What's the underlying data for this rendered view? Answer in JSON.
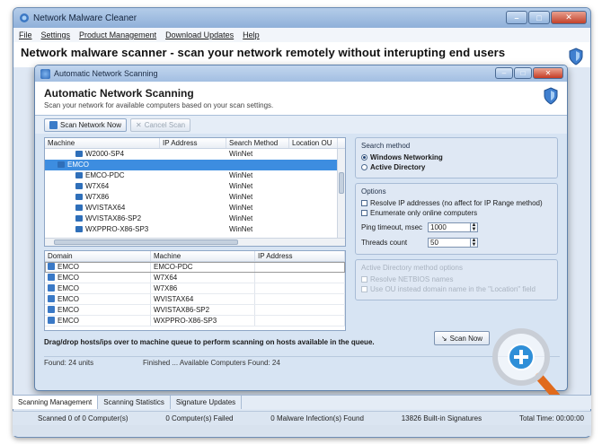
{
  "app": {
    "title": "Network Malware Cleaner"
  },
  "menu": [
    "File",
    "Settings",
    "Product Management",
    "Download Updates",
    "Help"
  ],
  "banner": {
    "title": "Network malware scanner - scan your network remotely without interupting end users"
  },
  "dialog": {
    "window_title": "Automatic Network Scanning",
    "heading": "Automatic Network Scanning",
    "subheading": "Scan your network for available computers based on your scan settings.",
    "toolbar": {
      "scan_network_now": "Scan Network Now",
      "cancel_scan": "Cancel Scan"
    },
    "tree": {
      "columns": [
        "Machine",
        "IP Address",
        "Search Method",
        "Location OU"
      ],
      "rows": [
        {
          "machine": "W2000-SP4",
          "ip": "",
          "method": "WinNet",
          "location": "",
          "selected": false
        },
        {
          "machine": "EMCO",
          "ip": "",
          "method": "",
          "location": "",
          "selected": true
        },
        {
          "machine": "EMCO-PDC",
          "ip": "",
          "method": "WinNet",
          "location": "",
          "selected": false
        },
        {
          "machine": "W7X64",
          "ip": "",
          "method": "WinNet",
          "location": "",
          "selected": false
        },
        {
          "machine": "W7X86",
          "ip": "",
          "method": "WinNet",
          "location": "",
          "selected": false
        },
        {
          "machine": "WVISTAX64",
          "ip": "",
          "method": "WinNet",
          "location": "",
          "selected": false
        },
        {
          "machine": "WVISTAX86-SP2",
          "ip": "",
          "method": "WinNet",
          "location": "",
          "selected": false
        },
        {
          "machine": "WXPPRO-X86-SP3",
          "ip": "",
          "method": "WinNet",
          "location": "",
          "selected": false
        }
      ]
    },
    "queue": {
      "columns": [
        "Domain",
        "Machine",
        "IP Address"
      ],
      "rows": [
        {
          "domain": "EMCO",
          "machine": "EMCO-PDC",
          "ip": ""
        },
        {
          "domain": "EMCO",
          "machine": "W7X64",
          "ip": ""
        },
        {
          "domain": "EMCO",
          "machine": "W7X86",
          "ip": ""
        },
        {
          "domain": "EMCO",
          "machine": "WVISTAX64",
          "ip": ""
        },
        {
          "domain": "EMCO",
          "machine": "WVISTAX86-SP2",
          "ip": ""
        },
        {
          "domain": "EMCO",
          "machine": "WXPPRO-X86-SP3",
          "ip": ""
        }
      ]
    },
    "search_method": {
      "title": "Search method",
      "options": [
        {
          "label": "Windows Networking",
          "selected": true
        },
        {
          "label": "Active Directory",
          "selected": false
        }
      ]
    },
    "options": {
      "title": "Options",
      "checkboxes": [
        "Resolve IP addresses (no affect for IP Range method)",
        "Enumerate only online computers"
      ],
      "ping_label": "Ping timeout, msec",
      "ping_value": "1000",
      "threads_label": "Threads count",
      "threads_value": "50"
    },
    "ad_options": {
      "title": "Active Directory method options",
      "checkboxes": [
        "Resolve NETBIOS names",
        "Use OU instead domain name in the \"Location\" field"
      ]
    },
    "drag_hint": "Drag/drop hosts/ips over to machine queue to perform scanning on hosts available in the queue.",
    "scan_now": "Scan Now",
    "status": {
      "found": "Found: 24 units",
      "finished": "Finished ... Available Computers Found: 24"
    }
  },
  "bottom_tabs": [
    "Scanning Management",
    "Scanning Statistics",
    "Signature Updates"
  ],
  "statusbar": {
    "scanned": "Scanned 0 of 0 Computer(s)",
    "failed": "0 Computer(s) Failed",
    "infections": "0 Malware Infection(s) Found",
    "signatures": "13826 Built-in Signatures",
    "total_time": "Total Time: 00:00:00"
  },
  "colors": {
    "selection": "#3d8de0",
    "title_gradient_top": "#b4cce9",
    "close_button": "#c2412b",
    "magnifier_handle": "#e06a1c"
  }
}
